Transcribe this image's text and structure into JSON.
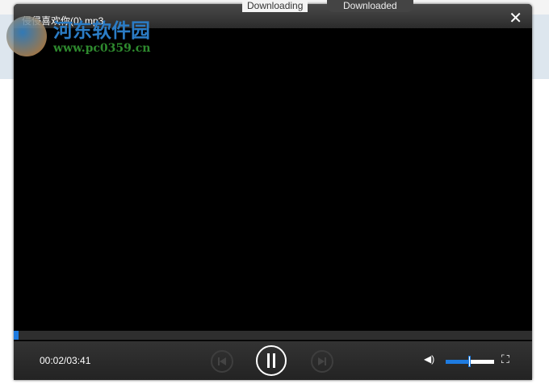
{
  "background": {
    "tabs": [
      "Downloading",
      "Downloaded"
    ]
  },
  "player": {
    "title": "侵侵喜欢你(0).mp3",
    "close_label": "✕",
    "progress_fraction": 0.009,
    "time": "00:02/03:41",
    "volume_fraction": 0.5,
    "accent": "#1e7be0",
    "icons": {
      "prev": "skip-previous-icon",
      "play": "pause-icon",
      "next": "skip-next-icon",
      "volume": "volume-icon",
      "fullscreen": "fullscreen-icon"
    }
  },
  "watermark": {
    "name": "河东软件园",
    "url": "www.pc0359.cn"
  }
}
